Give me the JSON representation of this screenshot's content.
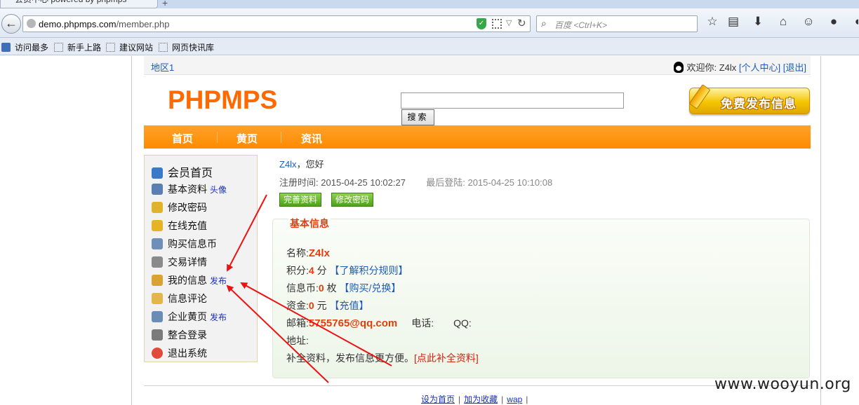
{
  "browser": {
    "tab_title": "会员中心 powered by phpmps",
    "tab_new": "+",
    "url_host": "demo.phpmps.com",
    "url_path": "/member.php",
    "search_placeholder": "百度 <Ctrl+K>",
    "bookmarks": [
      "访问最多",
      "新手上路",
      "建议网站",
      "网页快讯库"
    ],
    "toolbar_icons": [
      "star-icon",
      "reader-icon",
      "download-icon",
      "home-icon",
      "chat-icon",
      "speech-icon"
    ]
  },
  "header": {
    "region": "地区1",
    "welcome_prefix": "欢迎你: Z4lx",
    "user_center": "[个人中心]",
    "logout": "[退出]",
    "logo": "PHPMPS",
    "search_button": "搜索",
    "publish_button": "免费发布信息"
  },
  "nav": {
    "items": [
      "首页",
      "黄页",
      "资讯"
    ]
  },
  "sidebar": {
    "items": [
      {
        "label": "会员首页",
        "extra": "",
        "icon": "home-icon",
        "color": "#3a78c9"
      },
      {
        "label": "基本资料",
        "extra": "头像",
        "icon": "user-icon",
        "color": "#5a7fb0"
      },
      {
        "label": "修改密码",
        "extra": "",
        "icon": "key-icon",
        "color": "#e0b42a"
      },
      {
        "label": "在线充值",
        "extra": "",
        "icon": "coins-icon",
        "color": "#e6b422"
      },
      {
        "label": "购买信息币",
        "extra": "",
        "icon": "card-icon",
        "color": "#6f8fb8"
      },
      {
        "label": "交易详情",
        "extra": "",
        "icon": "cart-icon",
        "color": "#8a8a8a"
      },
      {
        "label": "我的信息",
        "extra": "发布",
        "icon": "flag-icon",
        "color": "#d9a232"
      },
      {
        "label": "信息评论",
        "extra": "",
        "icon": "folder-icon",
        "color": "#e3b64a"
      },
      {
        "label": "企业黄页",
        "extra": "发布",
        "icon": "company-user-icon",
        "color": "#6c8bb6"
      },
      {
        "label": "整合登录",
        "extra": "",
        "icon": "login-icon",
        "color": "#7b7b7b"
      },
      {
        "label": "退出系统",
        "extra": "",
        "icon": "exit-icon",
        "color": "#e04a3a"
      }
    ]
  },
  "content": {
    "username": "Z4lx",
    "greet_suffix": "，您好",
    "reg_label": "注册时间:",
    "reg_time": "2015-04-25 10:02:27",
    "last_label": "最后登陆:",
    "last_time": "2015-04-25 10:10:08",
    "btn_complete": "完善资料",
    "btn_password": "修改密码",
    "info_title": "基本信息",
    "name_label": "名称:",
    "name_value": "Z4lx",
    "points_label": "积分:",
    "points_value": "4",
    "points_unit": "分",
    "points_link": "【了解积分规则】",
    "coins_label": "信息币:",
    "coins_value": "0",
    "coins_unit": "枚",
    "coins_link": "【购买/兑换】",
    "funds_label": "资金:",
    "funds_value": "0",
    "funds_unit": "元",
    "funds_link": "【充值】",
    "email_label": "邮箱:",
    "email_value": "5755765@qq.com",
    "phone_label": "电话:",
    "qq_label": "QQ:",
    "address_label": "地址:",
    "tip_text": "补全资料，发布信息更方便。",
    "tip_link": "[点此补全资料]"
  },
  "footer": {
    "links": [
      "设为首页",
      "加为收藏",
      "wap"
    ],
    "sep": "|"
  },
  "watermark": "www.wooyun.org",
  "colors": {
    "accent_orange": "#ff8b00",
    "link_blue": "#1b5db8",
    "highlight_red": "#e23d0b",
    "annotation_red": "#ee1111"
  }
}
